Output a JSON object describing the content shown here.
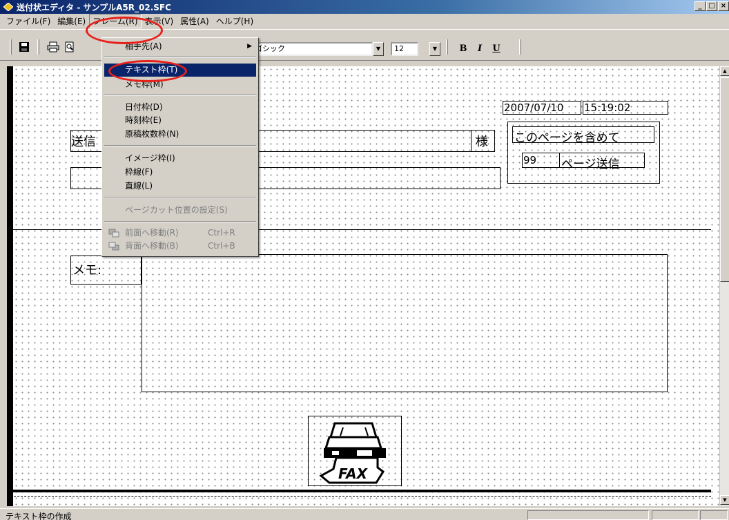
{
  "window": {
    "title": "送付状エディタ - サンプルA5R_02.SFC",
    "controls": [
      "_",
      "□",
      "×"
    ]
  },
  "menubar": {
    "items": [
      {
        "label": "ファイル(F)"
      },
      {
        "label": "編集(E)"
      },
      {
        "label": "フレーム(R)"
      },
      {
        "label": "表示(V)"
      },
      {
        "label": "属性(A)"
      },
      {
        "label": "ヘルプ(H)"
      }
    ]
  },
  "toolbar": {
    "font_name": "ゴシック",
    "font_size": "12",
    "bold": "B",
    "italic": "I",
    "underline": "U"
  },
  "dropdown": {
    "items": [
      {
        "label": "相手先(A)",
        "submenu": true
      },
      {
        "label": "テキスト枠(T)",
        "highlighted": true
      },
      {
        "label": "メモ枠(M)"
      },
      {
        "label": "日付枠(D)"
      },
      {
        "label": "時刻枠(E)"
      },
      {
        "label": "原稿枚数枠(N)"
      },
      {
        "label": "イメージ枠(I)"
      },
      {
        "label": "枠線(F)"
      },
      {
        "label": "直線(L)"
      },
      {
        "label": "ページカット位置の設定(S)",
        "disabled": true
      },
      {
        "label": "前面へ移動(R)",
        "shortcut": "Ctrl+R",
        "disabled": true
      },
      {
        "label": "背面へ移動(B)",
        "shortcut": "Ctrl+B",
        "disabled": true
      }
    ]
  },
  "document": {
    "sender_label": "送信",
    "recipient_suffix": "様",
    "date": "2007/07/10",
    "time": "15:19:02",
    "pages_caption": "このページを含めて",
    "page_count": "99",
    "pages_suffix": "ページ送信",
    "memo_label": "メモ:",
    "fax_logo_text": "FAX"
  },
  "statusbar": {
    "text": "テキスト枠の作成"
  },
  "colors": {
    "title_bar": "#0a246a",
    "menu_highlight": "#0a246a",
    "annotation_oval": "#e8201a"
  }
}
